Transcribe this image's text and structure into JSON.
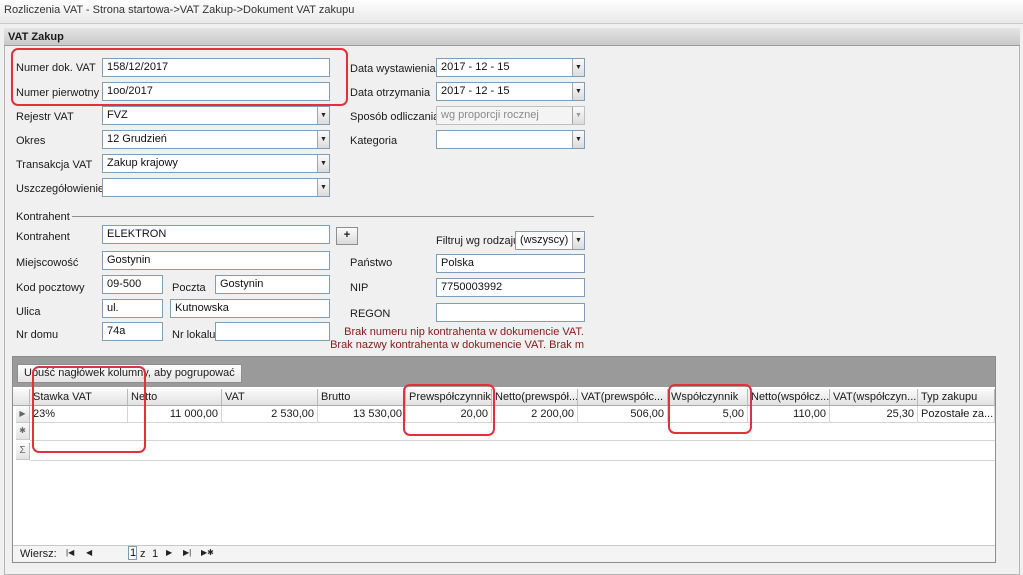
{
  "window": {
    "title": "Rozliczenia VAT - Strona startowa->VAT Zakup->Dokument VAT zakupu"
  },
  "panel": {
    "title": "VAT Zakup"
  },
  "form": {
    "numer_dok": {
      "label": "Numer dok. VAT",
      "value": "158/12/2017"
    },
    "numer_pierwotny": {
      "label": "Numer pierwotny",
      "value": "1oo/2017"
    },
    "rejestr": {
      "label": "Rejestr VAT",
      "value": "FVZ"
    },
    "okres": {
      "label": "Okres",
      "value": "12 Grudzień"
    },
    "transakcja": {
      "label": "Transakcja VAT",
      "value": "Zakup krajowy"
    },
    "uszczegolowienie": {
      "label": "Uszczegółowienie",
      "value": ""
    },
    "data_wystawienia": {
      "label": "Data wystawienia",
      "value": "2017 - 12 - 15"
    },
    "data_otrzymania": {
      "label": "Data otrzymania",
      "value": "2017 - 12 - 15"
    },
    "sposob": {
      "label": "Sposób odliczania",
      "value": "wg proporcji rocznej"
    },
    "kategoria": {
      "label": "Kategoria",
      "value": ""
    }
  },
  "kontrahent": {
    "section_label": "Kontrahent",
    "kontrahent": {
      "label": "Kontrahent",
      "value": "ELEKTRON"
    },
    "add_button": "+",
    "filtr": {
      "label": "Filtruj wg rodzaju",
      "value": "(wszyscy)"
    },
    "miejscowosc": {
      "label": "Miejscowość",
      "value": "Gostynin"
    },
    "panstwo": {
      "label": "Państwo",
      "value": "Polska"
    },
    "kod": {
      "label": "Kod pocztowy",
      "value": "09-500"
    },
    "poczta": {
      "label": "Poczta",
      "value": "Gostynin"
    },
    "nip": {
      "label": "NIP",
      "value": "7750003992"
    },
    "ulica": {
      "label": "Ulica",
      "prefix": "ul.",
      "value": "Kutnowska"
    },
    "regon": {
      "label": "REGON",
      "value": ""
    },
    "nr_domu": {
      "label": "Nr domu",
      "value": "74a"
    },
    "nr_lokalu": {
      "label": "Nr lokalu",
      "value": ""
    },
    "warnings": [
      "Brak numeru nip kontrahenta w dokumencie VAT.",
      "Brak nazwy kontrahenta w dokumencie VAT. Brak m"
    ]
  },
  "grid": {
    "group_hint": "Upuść nagłówek kolumny, aby pogrupować",
    "columns": [
      "Stawka VAT",
      "Netto",
      "VAT",
      "Brutto",
      "Prewspółczynnik",
      "Netto(prewspół...",
      "VAT(prewspółc...",
      "Współczynnik",
      "Netto(współcz...",
      "VAT(współczyn...",
      "Typ zakupu"
    ],
    "rows": [
      [
        "23%",
        "11 000,00",
        "2 530,00",
        "13 530,00",
        "20,00",
        "2 200,00",
        "506,00",
        "5,00",
        "110,00",
        "25,30",
        "Pozostałe za..."
      ]
    ]
  },
  "navigator": {
    "label": "Wiersz:",
    "current": "1",
    "of": "z",
    "total": "1"
  }
}
